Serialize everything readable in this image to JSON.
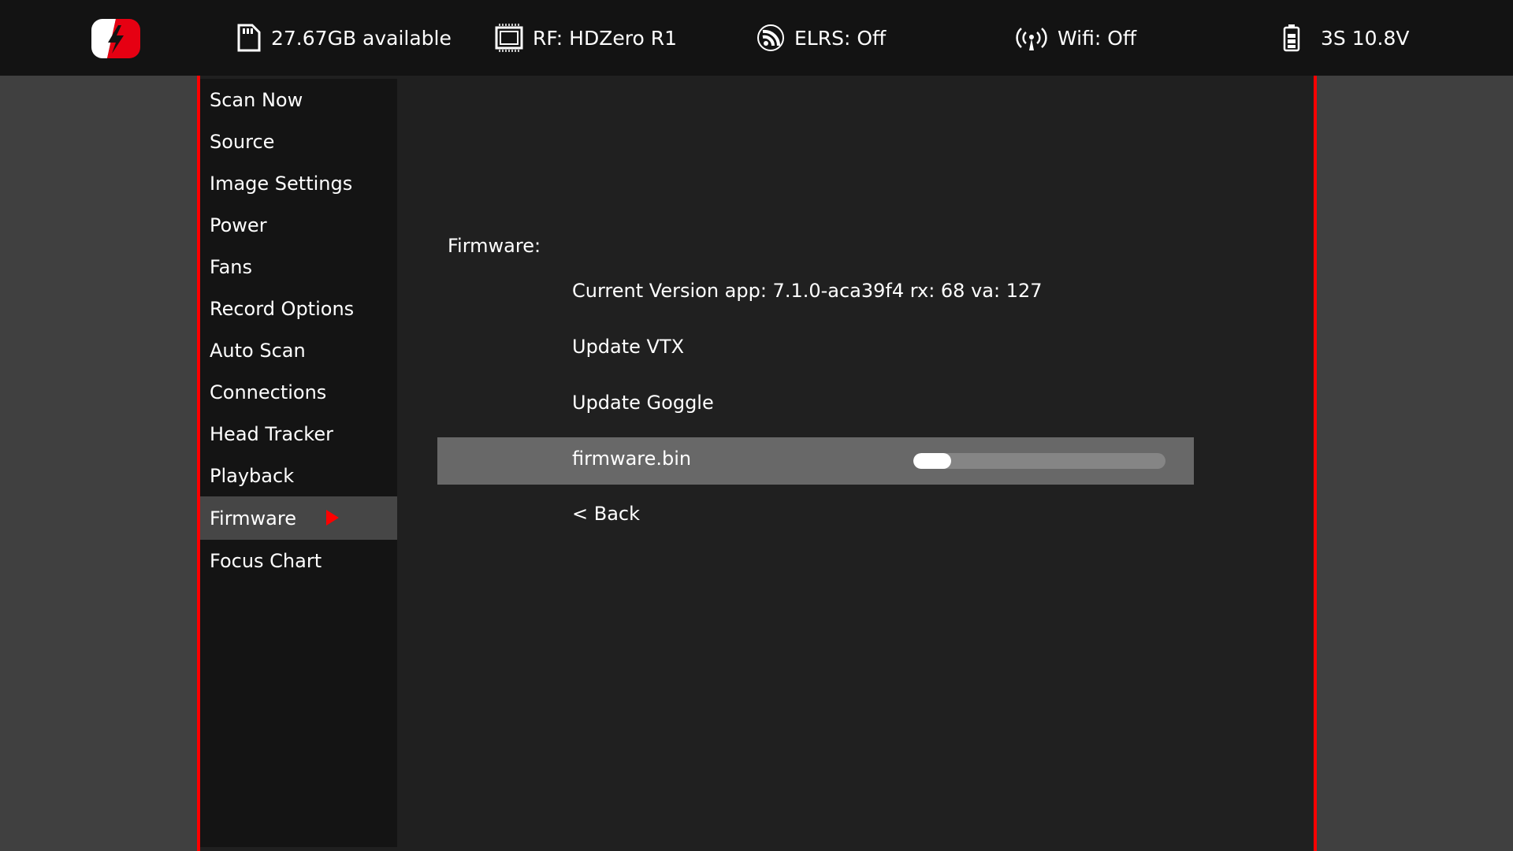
{
  "header": {
    "logo": "hdzero-logo",
    "storage": {
      "icon": "sd-card-icon",
      "text": "27.67GB available"
    },
    "rf": {
      "icon": "chip-icon",
      "text": "RF: HDZero R1"
    },
    "elrs": {
      "icon": "elrs-icon",
      "text": "ELRS: Off"
    },
    "wifi": {
      "icon": "wifi-antenna-icon",
      "text": "Wifi: Off"
    },
    "battery": {
      "icon": "battery-icon",
      "text": "3S 10.8V"
    }
  },
  "sidebar": {
    "items": [
      {
        "label": "Scan Now"
      },
      {
        "label": "Source"
      },
      {
        "label": "Image Settings"
      },
      {
        "label": "Power"
      },
      {
        "label": "Fans"
      },
      {
        "label": "Record Options"
      },
      {
        "label": "Auto Scan"
      },
      {
        "label": "Connections"
      },
      {
        "label": "Head Tracker"
      },
      {
        "label": "Playback"
      },
      {
        "label": "Firmware",
        "active": true
      },
      {
        "label": "Focus Chart"
      }
    ]
  },
  "main": {
    "title": "Firmware:",
    "current_version": "Current Version app: 7.1.0-aca39f4 rx: 68 va: 127",
    "update_vtx": "Update VTX",
    "update_goggle": "Update Goggle",
    "file": {
      "name": "firmware.bin",
      "progress": 0.15
    },
    "back": "< Back"
  },
  "colors": {
    "accent": "#ff0000",
    "selected_row": "#686868",
    "active_sidebar": "#464646"
  }
}
